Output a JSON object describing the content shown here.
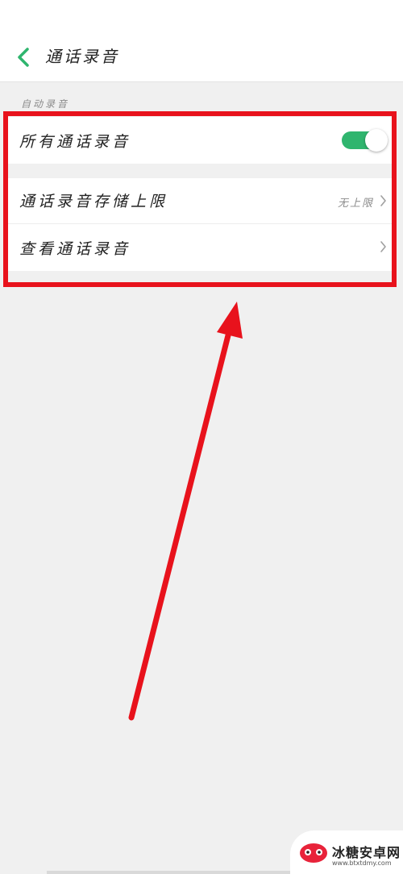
{
  "header": {
    "title": "通话录音",
    "back_icon": "chevron-left-icon"
  },
  "colors": {
    "accent": "#2fb56e",
    "highlight": "#e8121c",
    "background": "#f0f0f0"
  },
  "section": {
    "label": "自动录音"
  },
  "settings": {
    "all_calls": {
      "label": "所有通话录音",
      "toggle_on": true
    },
    "storage_limit": {
      "label": "通话录音存储上限",
      "value": "无上限"
    },
    "view_recordings": {
      "label": "查看通话录音"
    }
  },
  "watermark": {
    "title": "冰糖安卓网",
    "url": "www.btxtdmy.com"
  }
}
